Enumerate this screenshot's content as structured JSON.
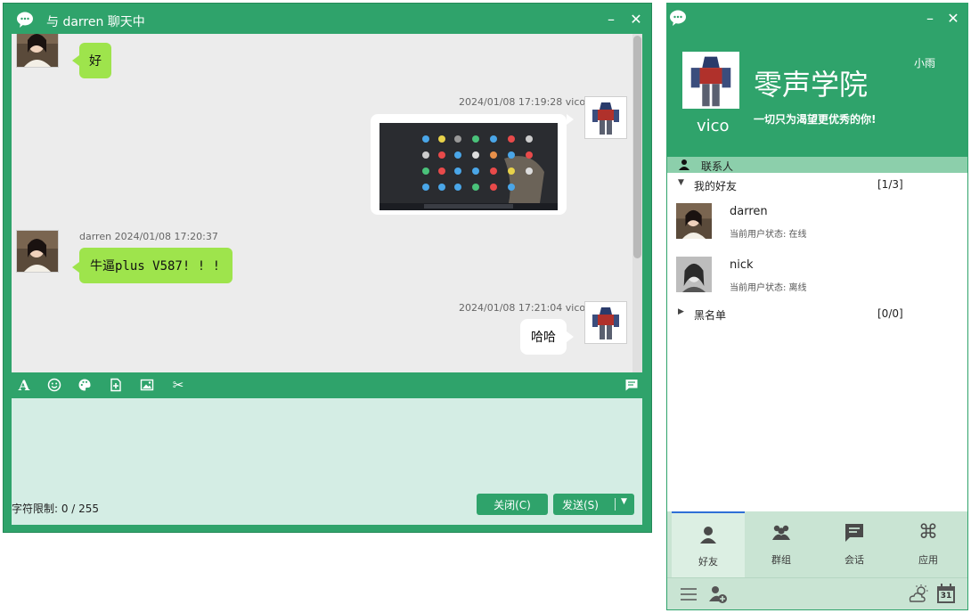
{
  "chat": {
    "title": "与 darren 聊天中",
    "messages": [
      {
        "sender": "darren",
        "text": "好"
      },
      {
        "sender": "vico",
        "meta": "2024/01/08 17:19:28  vico",
        "attachment": "screenshot-image"
      },
      {
        "sender": "darren",
        "meta": "darren 2024/01/08 17:20:37",
        "text": "牛逼plus V587! ! !"
      },
      {
        "sender": "vico",
        "meta": "2024/01/08 17:21:04  vico",
        "text": "哈哈"
      }
    ],
    "toolbar": [
      "font-icon",
      "emoji-icon",
      "palette-icon",
      "file-add-icon",
      "image-icon",
      "scissors-icon",
      "history-icon"
    ],
    "input": {
      "value": "",
      "char_limit": "字符限制: 0 / 255"
    },
    "close_button": "关闭(C)",
    "send_button": "发送(S)"
  },
  "main": {
    "brand_title": "零声学院",
    "slogan": "一切只为渴望更优秀的你!",
    "nick": "小雨",
    "username": "vico",
    "contacts_header": "联系人",
    "groups": [
      {
        "name": "我的好友",
        "count": "[1/3]",
        "expanded": true
      },
      {
        "name": "黑名单",
        "count": "[0/0]",
        "expanded": false
      }
    ],
    "friends": [
      {
        "name": "darren",
        "status": "当前用户状态: 在线"
      },
      {
        "name": "nick",
        "status": "当前用户状态: 离线"
      }
    ],
    "tabs": [
      {
        "label": "好友",
        "icon": "person-icon",
        "active": true
      },
      {
        "label": "群组",
        "icon": "group-icon",
        "active": false
      },
      {
        "label": "会话",
        "icon": "chat-icon",
        "active": false
      },
      {
        "label": "应用",
        "icon": "command-icon",
        "active": false
      }
    ],
    "calendar_day": "31"
  },
  "colors": {
    "primary": "#2fa36b",
    "bubble_green": "#9ee44c",
    "chat_bg": "#ececec",
    "input_bg": "#d4ede4",
    "tab_bg": "#c9e4d3"
  }
}
